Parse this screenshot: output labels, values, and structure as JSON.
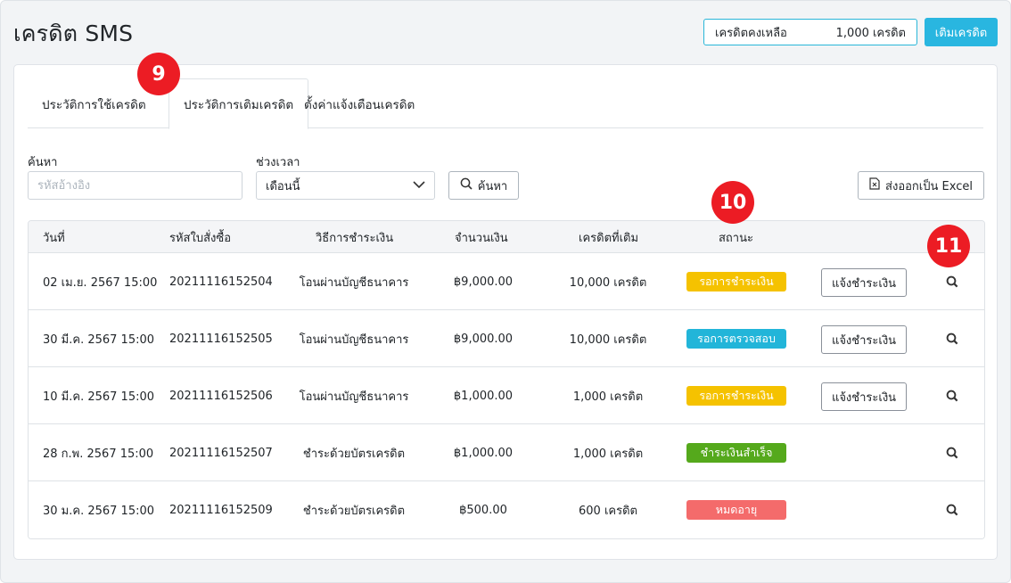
{
  "page": {
    "title": "เครดิต SMS",
    "credit_label": "เครดิตคงเหลือ",
    "credit_value": "1,000 เครดิต",
    "topup_label": "เติมเครดิต"
  },
  "tabs": [
    {
      "label": "ประวัติการใช้เครดิต"
    },
    {
      "label": "ประวัติการเติมเครดิต"
    },
    {
      "label": "ตั้งค่าแจ้งเตือนเครดิต"
    }
  ],
  "filters": {
    "search_label": "ค้นหา",
    "search_placeholder": "รหัสอ้างอิง",
    "period_label": "ช่วงเวลา",
    "period_value": "เดือนนี้",
    "search_button": "ค้นหา",
    "export_button": "ส่งออกเป็น Excel"
  },
  "table": {
    "headers": [
      "วันที่",
      "รหัสใบสั่งซื้อ",
      "วิธีการชำระเงิน",
      "จำนวนเงิน",
      "เครดิตที่เติม",
      "สถานะ"
    ],
    "action_label": "แจ้งชำระเงิน",
    "rows": [
      {
        "date": "02 เม.ย. 2567 15:00",
        "order": "20211116152504",
        "method": "โอนผ่านบัญชีธนาคาร",
        "amount": "฿9,000.00",
        "credit": "10,000 เครดิต",
        "status": "รอการชำระเงิน",
        "status_color": "#f5c200",
        "has_action": true
      },
      {
        "date": "30 มี.ค. 2567 15:00",
        "order": "20211116152505",
        "method": "โอนผ่านบัญชีธนาคาร",
        "amount": "฿9,000.00",
        "credit": "10,000 เครดิต",
        "status": "รอการตรวจสอบ",
        "status_color": "#22b5d9",
        "has_action": true
      },
      {
        "date": "10 มี.ค. 2567 15:00",
        "order": "20211116152506",
        "method": "โอนผ่านบัญชีธนาคาร",
        "amount": "฿1,000.00",
        "credit": "1,000 เครดิต",
        "status": "รอการชำระเงิน",
        "status_color": "#f5c200",
        "has_action": true
      },
      {
        "date": "28 ก.พ. 2567 15:00",
        "order": "20211116152507",
        "method": "ชำระด้วยบัตรเครดิต",
        "amount": "฿1,000.00",
        "credit": "1,000 เครดิต",
        "status": "ชำระเงินสำเร็จ",
        "status_color": "#55a91c",
        "has_action": false
      },
      {
        "date": "30 ม.ค. 2567 15:00",
        "order": "20211116152509",
        "method": "ชำระด้วยบัตรเครดิต",
        "amount": "฿500.00",
        "credit": "600 เครดิต",
        "status": "หมดอายุ",
        "status_color": "#f46b6b",
        "has_action": false
      }
    ]
  },
  "markers": {
    "m9": "9",
    "m10": "10",
    "m11": "11"
  },
  "colors": {
    "accent": "#29b6e0",
    "marker": "#ec1c24"
  }
}
